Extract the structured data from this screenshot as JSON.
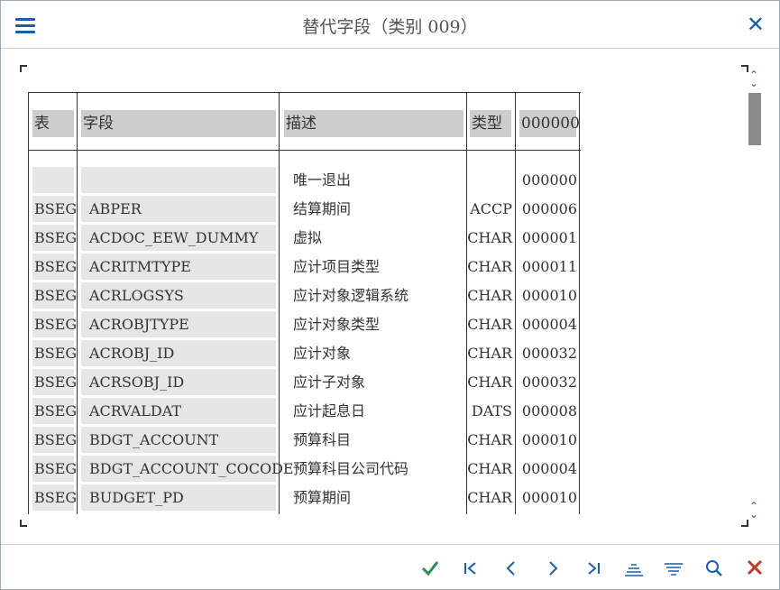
{
  "dialog": {
    "title": "替代字段（类别 009）"
  },
  "columns": {
    "table": "表",
    "field": "字段",
    "description": "描述",
    "type": "类型",
    "length": "000000"
  },
  "rows": [
    {
      "table": "",
      "field": "",
      "description": "唯一退出",
      "type": "",
      "length": "000000"
    },
    {
      "table": "BSEG",
      "field": "ABPER",
      "description": "结算期间",
      "type": "ACCP",
      "length": "000006"
    },
    {
      "table": "BSEG",
      "field": "ACDOC_EEW_DUMMY",
      "description": "虚拟",
      "type": "CHAR",
      "length": "000001"
    },
    {
      "table": "BSEG",
      "field": "ACRITMTYPE",
      "description": "应计项目类型",
      "type": "CHAR",
      "length": "000011"
    },
    {
      "table": "BSEG",
      "field": "ACRLOGSYS",
      "description": "应计对象逻辑系统",
      "type": "CHAR",
      "length": "000010"
    },
    {
      "table": "BSEG",
      "field": "ACROBJTYPE",
      "description": "应计对象类型",
      "type": "CHAR",
      "length": "000004"
    },
    {
      "table": "BSEG",
      "field": "ACROBJ_ID",
      "description": "应计对象",
      "type": "CHAR",
      "length": "000032"
    },
    {
      "table": "BSEG",
      "field": "ACRSOBJ_ID",
      "description": "应计子对象",
      "type": "CHAR",
      "length": "000032"
    },
    {
      "table": "BSEG",
      "field": "ACRVALDAT",
      "description": "应计起息日",
      "type": "DATS",
      "length": "000008"
    },
    {
      "table": "BSEG",
      "field": "BDGT_ACCOUNT",
      "description": "预算科目",
      "type": "CHAR",
      "length": "000010"
    },
    {
      "table": "BSEG",
      "field": "BDGT_ACCOUNT_COCODE",
      "description": "预算科目公司代码",
      "type": "CHAR",
      "length": "000004"
    },
    {
      "table": "BSEG",
      "field": "BUDGET_PD",
      "description": "预算期间",
      "type": "CHAR",
      "length": "000010"
    }
  ],
  "scroll": {
    "up": "⌃",
    "down": "⌄"
  },
  "icons": {
    "menu": "menu-icon",
    "close": "close-icon",
    "confirm": "checkmark-icon",
    "first": "first-page-icon",
    "prev": "previous-icon",
    "next": "next-icon",
    "last": "last-page-icon",
    "sort-asc": "sort-ascending-icon",
    "sort-desc": "sort-descending-icon",
    "find": "search-icon",
    "cancel": "cancel-icon"
  },
  "colors": {
    "accent": "#1b5ea6",
    "confirm": "#2e8b57",
    "cancel": "#c0392b",
    "header_bg": "#cdcdcd",
    "key_bg": "#e6e6e6"
  }
}
